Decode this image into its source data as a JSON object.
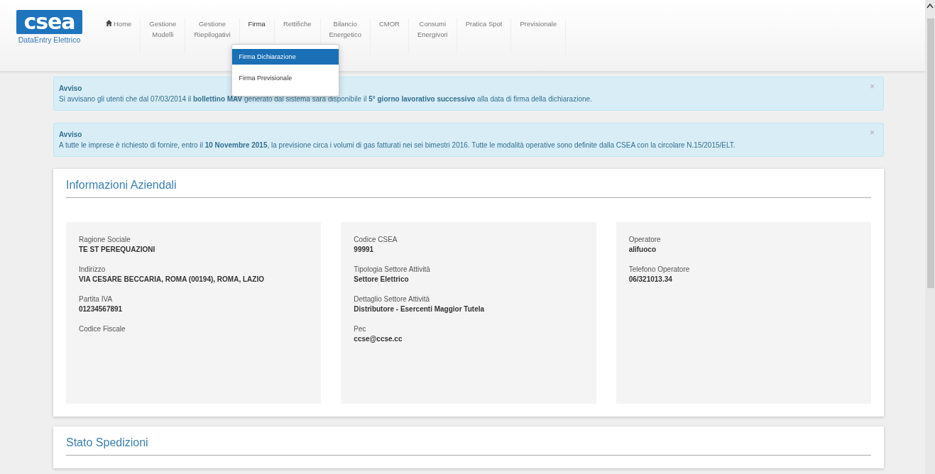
{
  "brand": {
    "logo": "csea",
    "subtitle": "DataEntry Elettrico"
  },
  "nav": [
    {
      "lines": [
        "Home"
      ],
      "kind": "icon-link",
      "open": false
    },
    {
      "lines": [
        "Gestione",
        "Modelli"
      ],
      "open": false
    },
    {
      "lines": [
        "Gestione",
        "Riepilogativi"
      ],
      "open": false
    },
    {
      "lines": [
        "Firma"
      ],
      "open": true,
      "menu": [
        {
          "label": "Firma Dichiarazione",
          "selected": true
        },
        {
          "label": "Firma Previsionale",
          "selected": false
        }
      ]
    },
    {
      "lines": [
        "Rettifiche"
      ],
      "open": false
    },
    {
      "lines": [
        "Bilancio",
        "Energetico"
      ],
      "open": false
    },
    {
      "lines": [
        "CMOR"
      ],
      "open": false
    },
    {
      "lines": [
        "Consumi",
        "Energivori"
      ],
      "open": false
    },
    {
      "lines": [
        "Pratica Spot"
      ],
      "open": false
    },
    {
      "lines": [
        "Previsionale"
      ],
      "open": false
    }
  ],
  "alerts": [
    {
      "title": "Avviso",
      "text": "Si avvisano gli utenti che dal 07/03/2014 il **bollettino MAV** generato dal sistema sarà disponibile il **5° giorno lavorativo successivo** alla data di firma della dichiarazione.",
      "close": "×"
    },
    {
      "title": "Avviso",
      "text": "A tutte le imprese è richiesto di fornire, entro il **10 Novembre 2015**, la previsione circa i volumi di gas fatturati nei sei bimestri 2016. Tutte le modalità operative sono definite dalla CSEA con la circolare N.15/2015/ELT.",
      "close": "×"
    }
  ],
  "company": {
    "title": "Informazioni Aziendali",
    "columns": [
      [
        {
          "label": "Ragione Sociale",
          "value": "TE ST PEREQUAZIONI"
        },
        {
          "label": "Indirizzo",
          "value": "VIA CESARE BECCARIA, ROMA (00194), ROMA, LAZIO"
        },
        {
          "label": "Partita IVA",
          "value": "01234567891"
        },
        {
          "label": "Codice Fiscale"
        }
      ],
      [
        {
          "label": "Codice CSEA",
          "value": "99991"
        },
        {
          "label": "Tipologia Settore Attività",
          "value": "Settore Elettrico"
        },
        {
          "label": "Dettaglio Settore Attività",
          "value": "Distributore - Esercenti Maggior Tutela"
        },
        {
          "label": "Pec",
          "value": "ccse@ccse.cc"
        }
      ],
      [
        {
          "label": "Operatore",
          "value": "alifuoco"
        },
        {
          "label": "Telefono Operatore",
          "value": "06/321013.34"
        }
      ]
    ]
  },
  "shipments": {
    "title": "Stato Spedizioni"
  }
}
